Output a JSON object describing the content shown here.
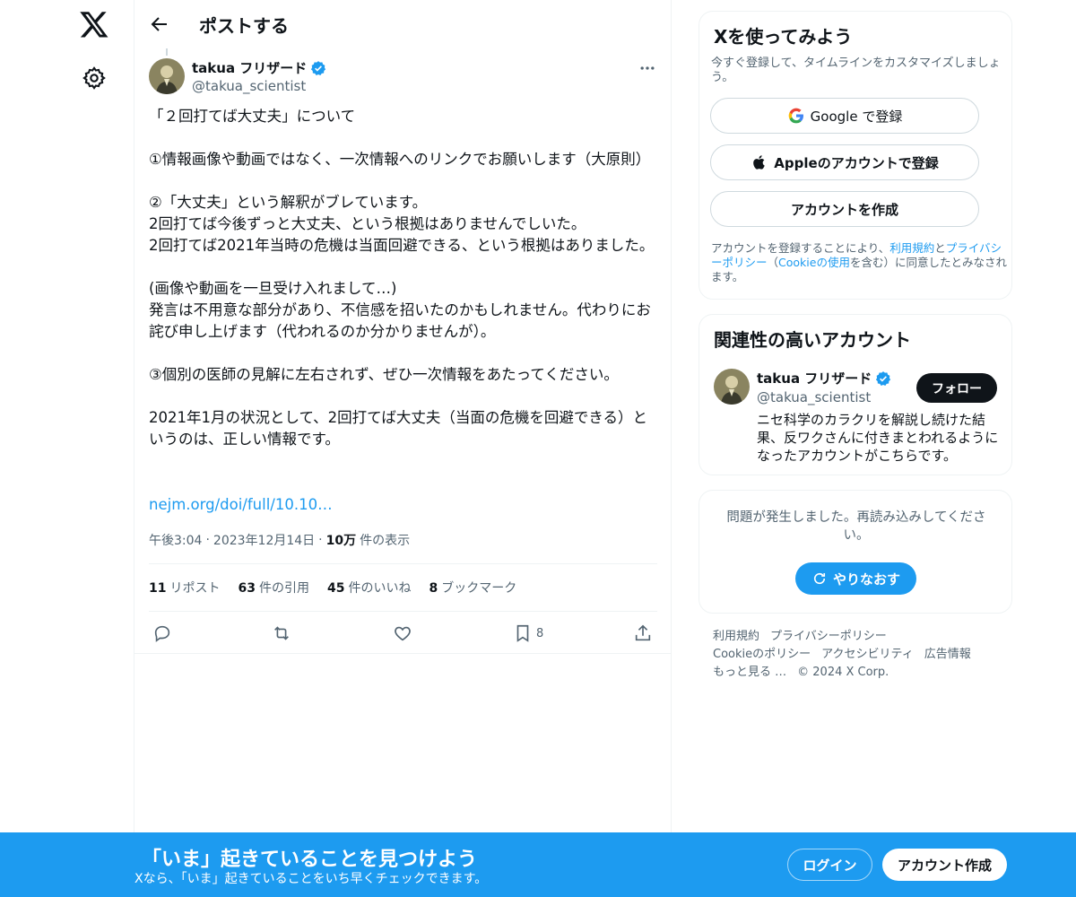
{
  "header": {
    "title": "ポストする"
  },
  "tweet": {
    "author_name": "takua フリザード",
    "author_handle": "@takua_scientist",
    "body": "「２回打てば大丈夫」について\n\n①情報画像や動画ではなく、一次情報へのリンクでお願いします（大原則）\n\n②「大丈夫」という解釈がブレています。\n2回打てば今後ずっと大丈夫、という根拠はありませんでしいた。\n2回打てば2021年当時の危機は当面回避できる、という根拠はありました。\n\n(画像や動画を一旦受け入れまして…)\n発言は不用意な部分があり、不信感を招いたのかもしれません。代わりにお詫び申し上げます（代われるのか分かりませんが）。\n\n③個別の医師の見解に左右されず、ぜひ一次情報をあたってください。\n\n2021年1月の状況として、2回打てば大丈夫（当面の危機を回避できる）というのは、正しい情報です。",
    "link": "nejm.org/doi/full/10.10…",
    "time": "午後3:04",
    "date": "2023年12月14日",
    "views_count": "10万",
    "views_label": "件の表示",
    "stats": {
      "reposts_count": "11",
      "reposts_label": "リポスト",
      "quotes_count": "63",
      "quotes_label": "件の引用",
      "likes_count": "45",
      "likes_label": "件のいいね",
      "bookmarks_count": "8",
      "bookmarks_label": "ブックマーク"
    },
    "bookmark_action_count": "8"
  },
  "signup": {
    "title": "Xを使ってみよう",
    "subtitle": "今すぐ登録して、タイムラインをカスタマイズしましょう。",
    "google_label": "Google で登録",
    "apple_label": "Appleのアカウントで登録",
    "create_label": "アカウントを作成",
    "terms_pre": "アカウントを登録することにより、",
    "terms_link1": "利用規約",
    "terms_and": "と",
    "terms_link2": "プライバシーポリシー",
    "terms_mid": "（",
    "terms_link3": "Cookieの使用",
    "terms_post": "を含む）に同意したとみなされます。"
  },
  "related": {
    "title": "関連性の高いアカウント",
    "name": "takua フリザード",
    "handle": "@takua_scientist",
    "follow_label": "フォロー",
    "bio": "ニセ科学のカラクリを解説し続けた結果、反ワクさんに付きまとわれるようになったアカウントがこちらです。"
  },
  "error": {
    "message": "問題が発生しました。再読み込みしてください。",
    "retry_label": "やりなおす"
  },
  "footer": {
    "links": [
      "利用規約",
      "プライバシーポリシー",
      "Cookieのポリシー",
      "アクセシビリティ",
      "広告情報",
      "もっと見る …",
      "© 2024 X Corp."
    ]
  },
  "bottombar": {
    "title": "「いま」起きていることを見つけよう",
    "subtitle": "Xなら、「いま」起きていることをいち早くチェックできます。",
    "login_label": "ログイン",
    "create_label": "アカウント作成"
  },
  "colors": {
    "accent": "#1d9bf0",
    "text": "#0f1419",
    "muted": "#536471",
    "border": "#eff3f4"
  }
}
